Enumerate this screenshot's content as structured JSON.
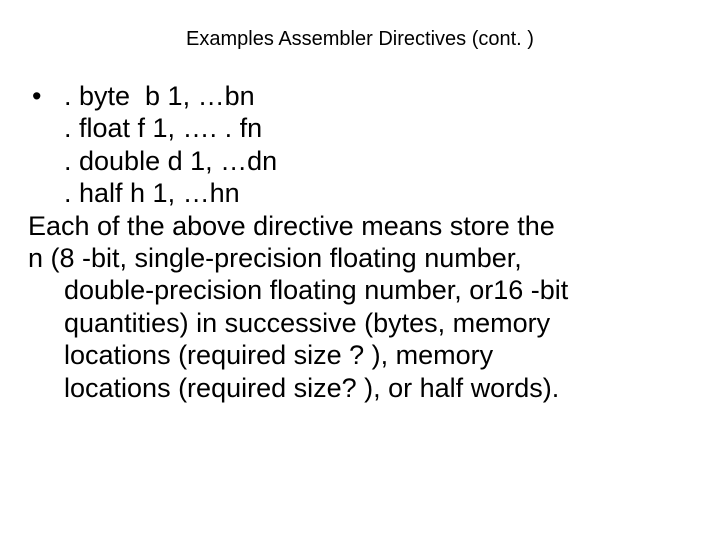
{
  "slide": {
    "title": "Examples Assembler Directives (cont. )",
    "bullet": "•",
    "lines": {
      "l1": ". byte  b 1, …bn",
      "l2": ". float f 1, …. . fn",
      "l3": ". double d 1, …dn",
      "l4": ". half h 1, …hn",
      "p1": "Each of the above directive means store the",
      "p2": "n (8 -bit, single-precision floating number,",
      "p3": "double-precision floating number, or16 -bit",
      "p4": "quantities) in successive (bytes, memory",
      "p5": "locations (required size ? ), memory",
      "p6": "locations (required size? ), or half words)."
    }
  }
}
